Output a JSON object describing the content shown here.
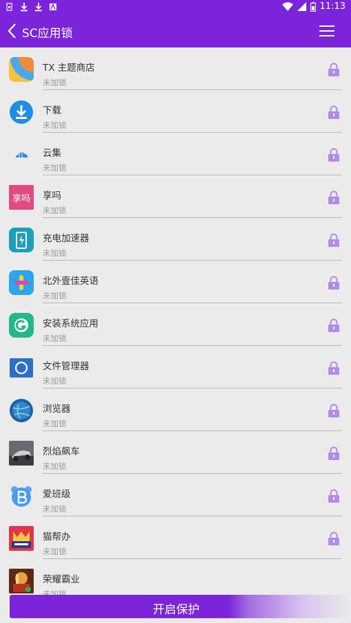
{
  "status_bar": {
    "time": "11:13",
    "left_icons": [
      "sim-icon",
      "download-icon",
      "download-icon",
      "notification-a-icon"
    ],
    "right_icons": [
      "wifi-icon",
      "signal-icon",
      "battery-icon"
    ]
  },
  "app_bar": {
    "title": "SC应用锁",
    "back_icon": "chevron-left-icon",
    "menu_icon": "hamburger-menu-icon"
  },
  "accent_color": "#7b24d9",
  "lock_color": "#b48ae8",
  "apps": [
    {
      "name": "TX 主题商店",
      "status": "未加锁",
      "icon": "theme-store-icon"
    },
    {
      "name": "下载",
      "status": "未加锁",
      "icon": "download-app-icon"
    },
    {
      "name": "云集",
      "status": "未加锁",
      "icon": "yunji-icon"
    },
    {
      "name": "享吗",
      "status": "未加锁",
      "icon": "xiangma-icon",
      "icon_text": "享吗"
    },
    {
      "name": "充电加速器",
      "status": "未加锁",
      "icon": "charging-icon"
    },
    {
      "name": "北外壹佳英语",
      "status": "未加锁",
      "icon": "english-app-icon"
    },
    {
      "name": "安装系统应用",
      "status": "未加锁",
      "icon": "install-icon"
    },
    {
      "name": "文件管理器",
      "status": "未加锁",
      "icon": "file-manager-icon"
    },
    {
      "name": "浏览器",
      "status": "未加锁",
      "icon": "browser-icon"
    },
    {
      "name": "烈焰飙车",
      "status": "未加锁",
      "icon": "racing-game-icon"
    },
    {
      "name": "爱班级",
      "status": "未加锁",
      "icon": "class-app-icon"
    },
    {
      "name": "猫帮办",
      "status": "未加锁",
      "icon": "cat-help-icon"
    },
    {
      "name": "荣耀霸业",
      "status": "未加锁",
      "icon": "strategy-game-icon"
    }
  ],
  "bottom_button": {
    "label": "开启保护"
  }
}
